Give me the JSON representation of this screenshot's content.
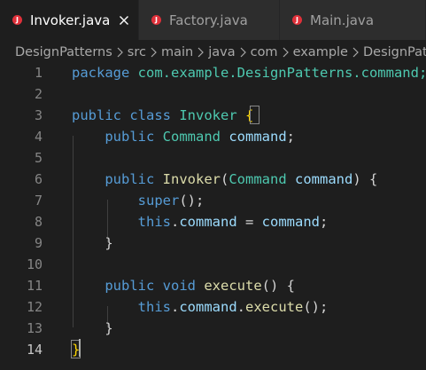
{
  "tabs": [
    {
      "label": "Invoker.java",
      "icon": "java-file-icon",
      "active": true
    },
    {
      "label": "Factory.java",
      "icon": "java-file-icon",
      "active": false
    },
    {
      "label": "Main.java",
      "icon": "java-file-icon",
      "active": false
    }
  ],
  "breadcrumb": [
    "DesignPatterns",
    "src",
    "main",
    "java",
    "com",
    "example",
    "DesignPatterns"
  ],
  "line_numbers": [
    "1",
    "2",
    "3",
    "4",
    "5",
    "6",
    "7",
    "8",
    "9",
    "10",
    "11",
    "12",
    "13",
    "14"
  ],
  "current_line": "14",
  "code": {
    "l1_kw": "package",
    "l1_rest": " com.example.DesignPatterns.command;",
    "l3_kw": "public class",
    "l3_type": "Invoker",
    "l3_brace": "{",
    "l4_kw": "public",
    "l4_type": "Command",
    "l4_var": "command",
    "l4_end": ";",
    "l6_kw": "public",
    "l6_func": "Invoker",
    "l6_paren_open": "(",
    "l6_type": "Command",
    "l6_var": "command",
    "l6_end": ") {",
    "l7_kw": "super",
    "l7_end": "();",
    "l8_kw": "this",
    "l8_dot": ".",
    "l8_var": "command",
    "l8_eq": " = ",
    "l8_var2": "command",
    "l8_end": ";",
    "l9_brace": "}",
    "l11_kw": "public void",
    "l11_func": "execute",
    "l11_end": "() {",
    "l12_kw": "this",
    "l12_dot": ".",
    "l12_var": "command",
    "l12_dot2": ".",
    "l12_func": "execute",
    "l12_end": "();",
    "l13_brace": "}",
    "l14_brace": "}"
  },
  "icon_letter": "J",
  "colors": {
    "keyword": "#569cd6",
    "type": "#4ec9b0",
    "variable": "#9cdcfe",
    "function": "#dcdcaa",
    "bracket": "#ffd700",
    "java_icon": "#e0303a"
  }
}
